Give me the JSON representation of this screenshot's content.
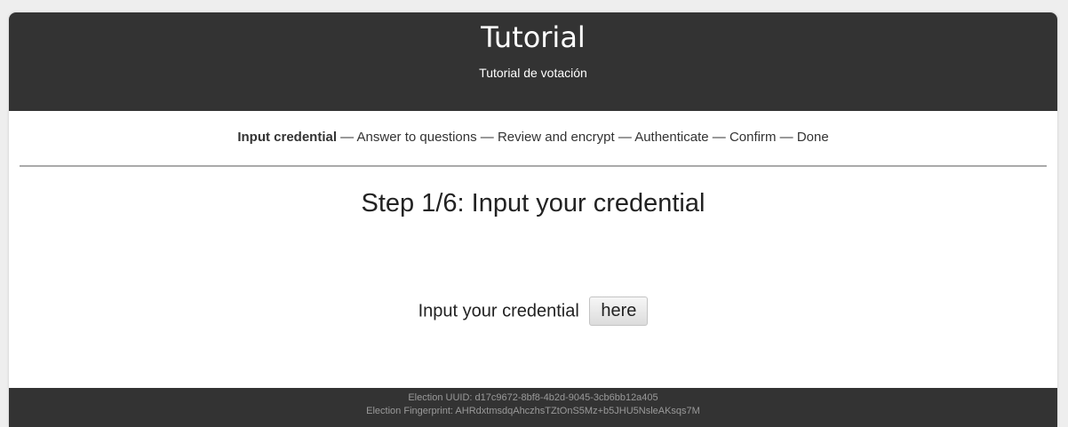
{
  "header": {
    "title": "Tutorial",
    "subtitle": "Tutorial de votación"
  },
  "steps": {
    "items": [
      "Input credential",
      "Answer to questions",
      "Review and encrypt",
      "Authenticate",
      "Confirm",
      "Done"
    ],
    "separator": " — ",
    "current_index": 0
  },
  "main": {
    "step_title": "Step 1/6: Input your credential",
    "credential_prompt": "Input your credential",
    "here_button_label": "here"
  },
  "footer": {
    "uuid_line": "Election UUID: d17c9672-8bf8-4b2d-9045-3cb6bb12a405",
    "fingerprint_line": "Election Fingerprint: AHRdxtmsdqAhczhsTZtOnS5Mz+b5JHU5NsleAKsqs7M"
  },
  "colors": {
    "header_bg": "#333333",
    "footer_bg": "#333333",
    "divider": "#aaaaaa"
  }
}
